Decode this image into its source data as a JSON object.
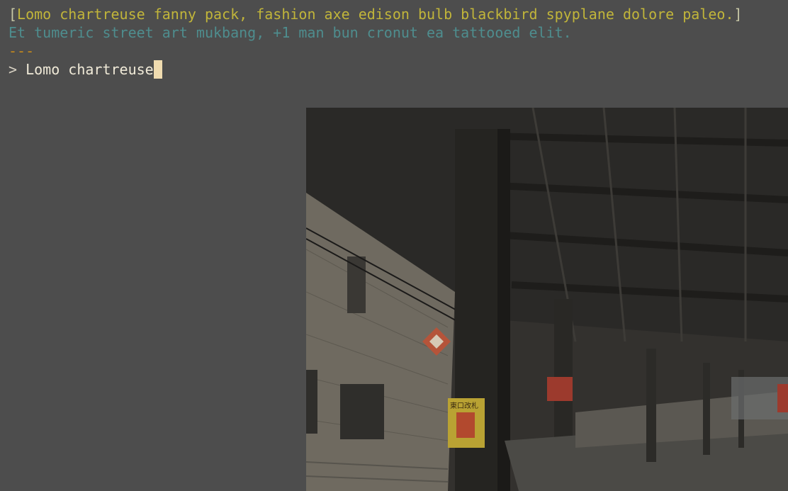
{
  "terminal": {
    "line1": {
      "open_bracket": "[",
      "text": "Lomo chartreuse fanny pack, fashion axe edison bulb blackbird spyplane dolore paleo.",
      "close_bracket": "]"
    },
    "line2": {
      "text": "Et tumeric street art mukbang, +1 man bun cronut ea tattooed elit."
    },
    "separator": "---",
    "prompt": {
      "symbol": ">",
      "input_value": "Lomo chartreuse"
    }
  },
  "colors": {
    "background": "#4d4d4d",
    "title_yellow": "#c1b53a",
    "subtitle_teal": "#4e8d8e",
    "separator_orange": "#c58a1c",
    "cursor": "#f0dcb0"
  },
  "image": {
    "sign_primary_text": "東口改札"
  }
}
